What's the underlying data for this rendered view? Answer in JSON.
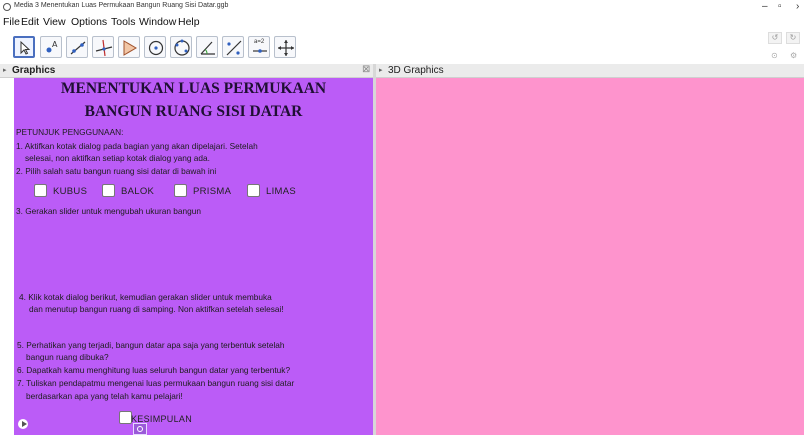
{
  "window": {
    "title": "Media 3 Menentukan Luas Permukaan Bangun Ruang Sisi Datar.ggb",
    "minimize": "–",
    "maximize": "▫",
    "close": "›"
  },
  "menu": [
    "File",
    "Edit",
    "View",
    "Options",
    "Tools",
    "Window",
    "Help"
  ],
  "toolbar": {
    "tools": [
      "move-tool",
      "point-tool",
      "line-tool",
      "perpendicular-tool",
      "polygon-tool",
      "circle-tool",
      "circle-three-points-tool",
      "angle-tool",
      "reflect-tool",
      "slider-tool",
      "move-view-tool"
    ],
    "slider_label": "a=2",
    "undo_label": "↺",
    "redo_label": "↻"
  },
  "panels": {
    "graphics": {
      "label": "Graphics",
      "close": "⊠"
    },
    "graphics3d": {
      "label": "3D Graphics"
    }
  },
  "content": {
    "heading_line1": "MENENTUKAN LUAS PERMUKAAN",
    "heading_line2": "BANGUN RUANG SISI DATAR",
    "petunjuk": "PETUNJUK PENGGUNAAN:",
    "step1a": "1. Aktifkan kotak dialog pada bagian yang akan dipelajari. Setelah",
    "step1b": "selesai, non aktifkan setiap kotak dialog yang ada.",
    "step2": "2. Pilih salah satu bangun ruang sisi datar di bawah ini",
    "options": [
      "KUBUS",
      "BALOK",
      "PRISMA",
      "LIMAS"
    ],
    "step3": "3. Gerakan slider untuk mengubah ukuran bangun",
    "step4a": "4. Klik kotak dialog berikut, kemudian gerakan slider untuk membuka",
    "step4b": "dan menutup bangun ruang di samping. Non aktifkan setelah selesai!",
    "step5a": "5. Perhatikan yang terjadi, bangun datar apa saja yang terbentuk setelah",
    "step5b": "bangun ruang dibuka?",
    "step6": "6. Dapatkah kamu menghitung luas seluruh bangun datar yang terbentuk?",
    "step7a": "7. Tuliskan pendapatmu mengenai luas permukaan bangun ruang sisi datar",
    "step7b": "berdasarkan apa yang telah kamu pelajari!",
    "kesimpulan": "KESIMPULAN"
  },
  "colors": {
    "graphics_bg": "#bb5cf7",
    "graphics3d_bg": "#fe94cd",
    "heading": "#1f0f33"
  }
}
